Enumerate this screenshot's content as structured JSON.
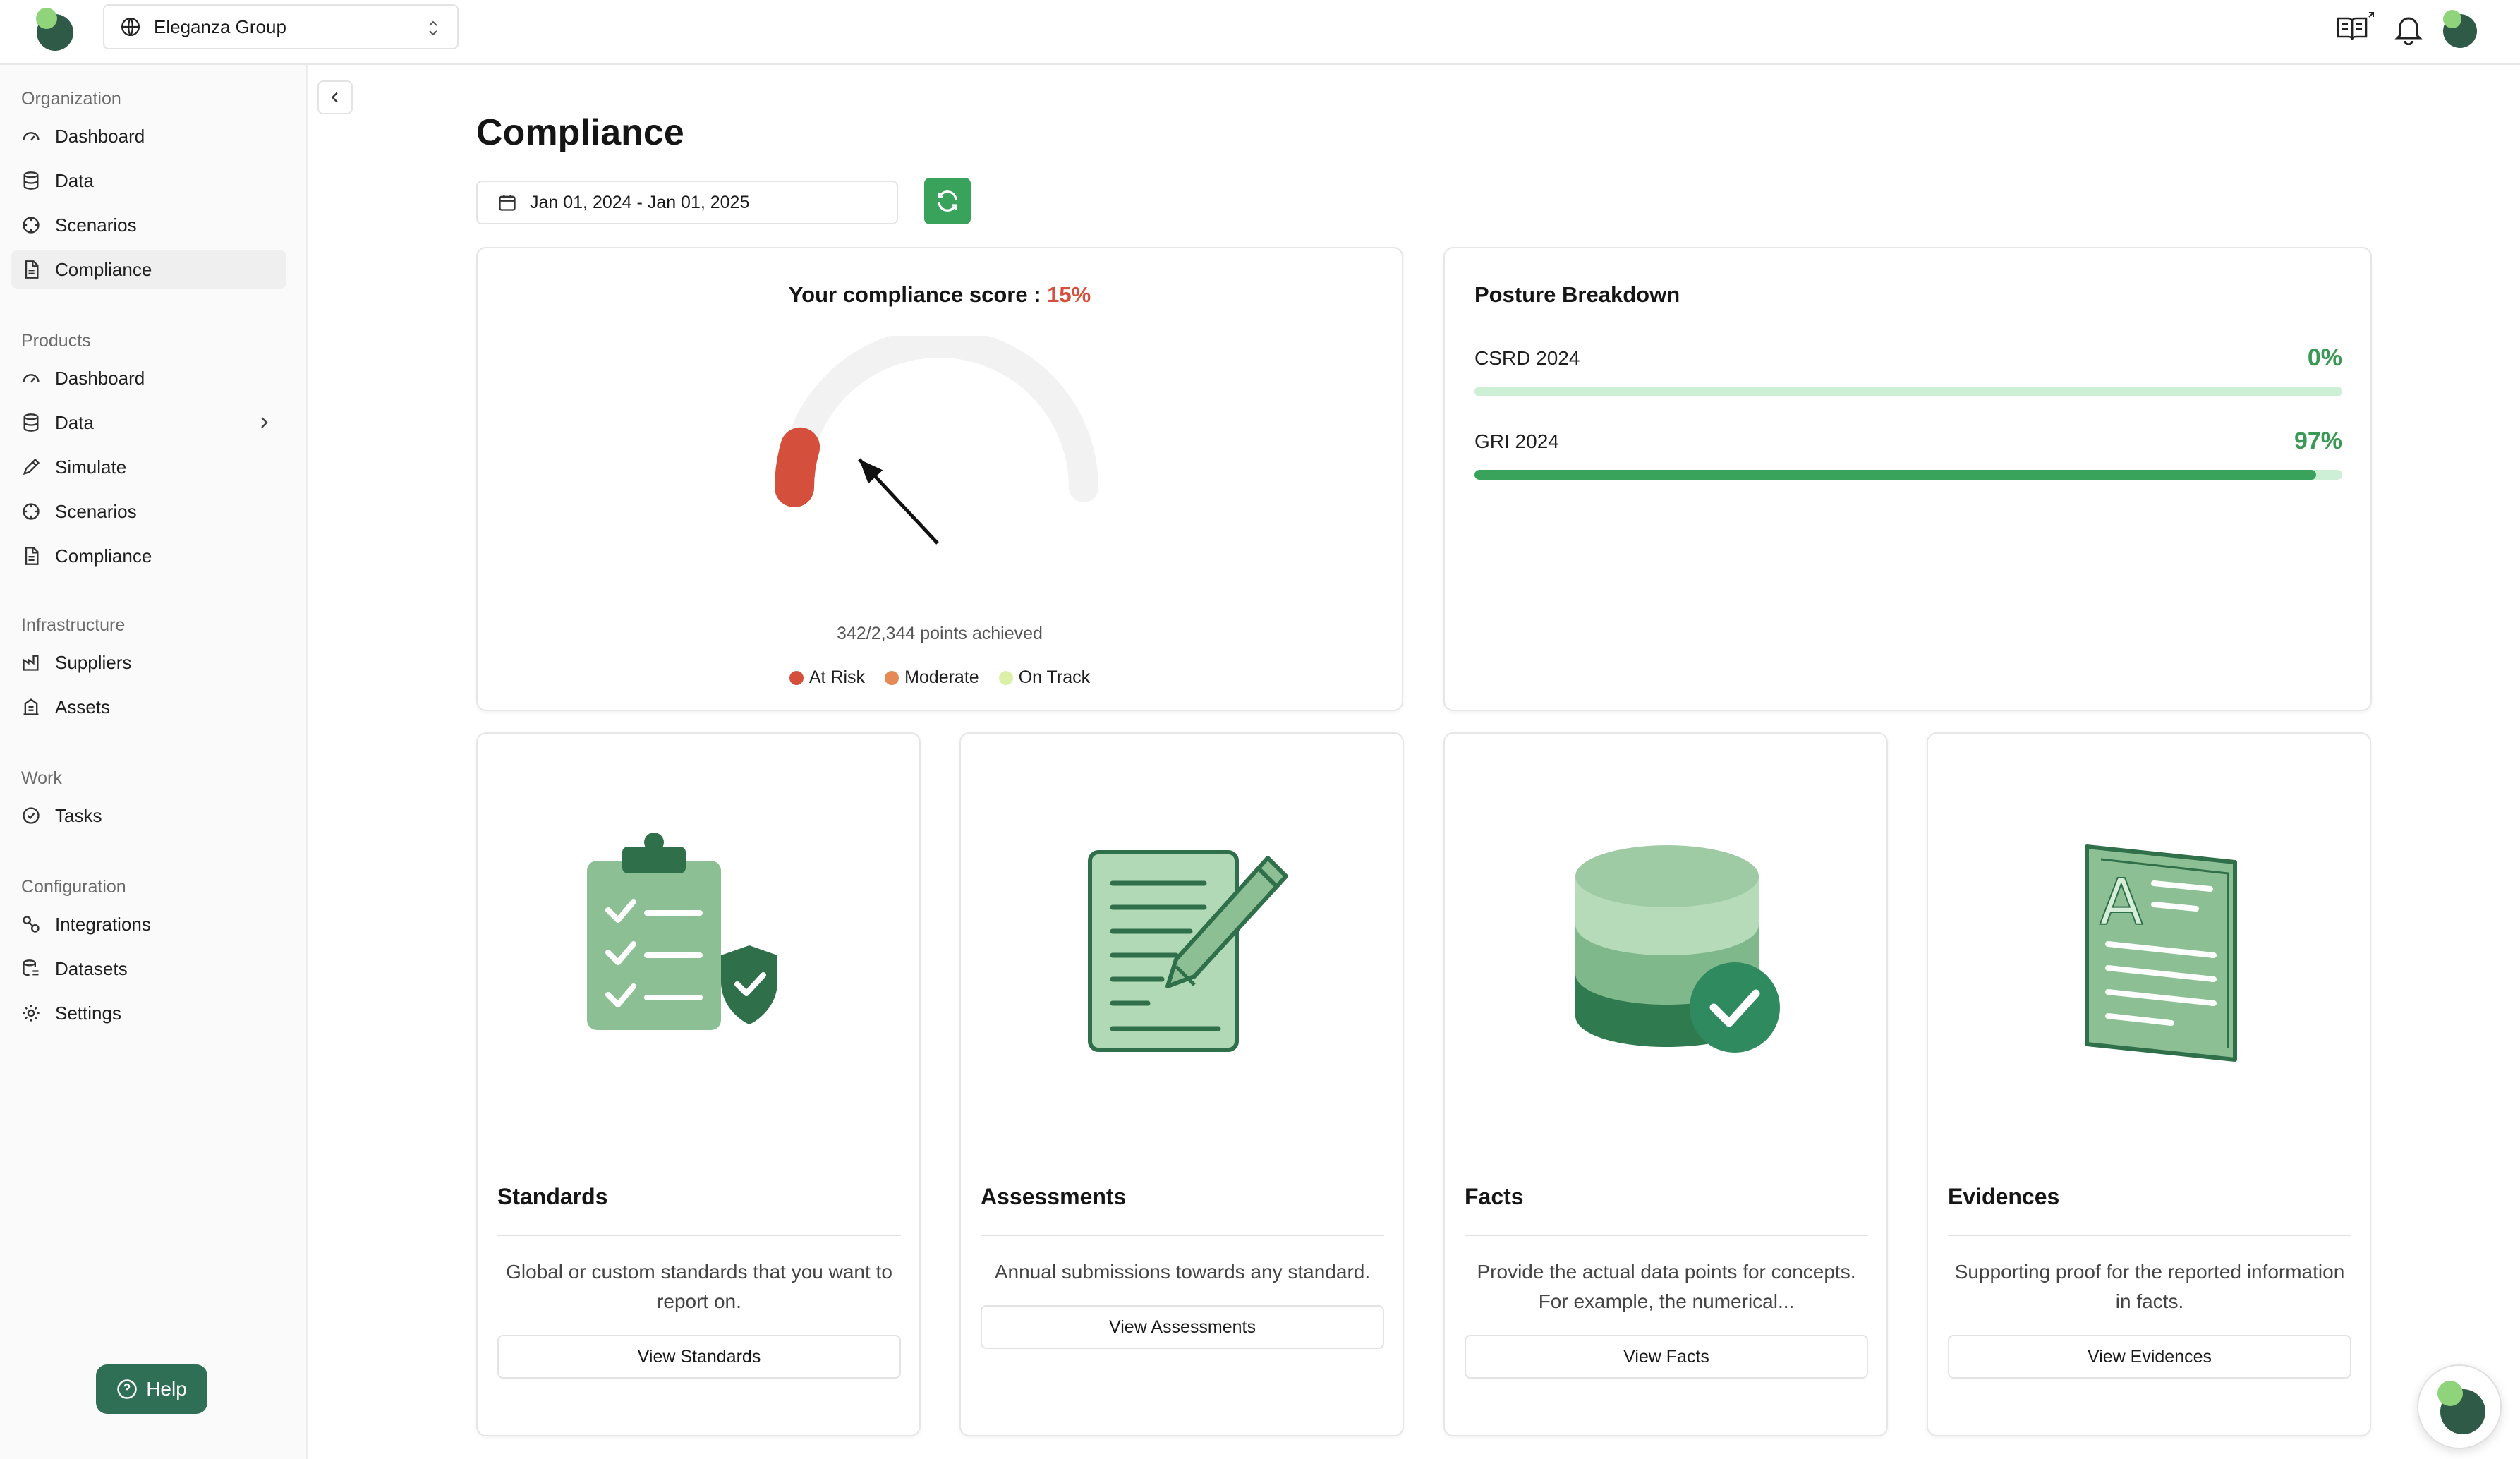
{
  "header": {
    "org_name": "Eleganza Group"
  },
  "sidebar": {
    "sections": [
      {
        "title": "Organization",
        "items": [
          "Dashboard",
          "Data",
          "Scenarios",
          "Compliance"
        ]
      },
      {
        "title": "Products",
        "items": [
          "Dashboard",
          "Data",
          "Simulate",
          "Scenarios",
          "Compliance"
        ]
      },
      {
        "title": "Infrastructure",
        "items": [
          "Suppliers",
          "Assets"
        ]
      },
      {
        "title": "Work",
        "items": [
          "Tasks"
        ]
      },
      {
        "title": "Configuration",
        "items": [
          "Integrations",
          "Datasets",
          "Settings"
        ]
      }
    ],
    "active_item": "Compliance",
    "help_label": "Help"
  },
  "main": {
    "title": "Compliance",
    "date_range": "Jan 01, 2024 - Jan 01, 2025"
  },
  "score": {
    "label": "Your compliance score :",
    "value": "15%",
    "fraction": 0.15,
    "points": "342/2,344 points achieved",
    "legend": [
      {
        "label": "At Risk",
        "color": "#d4503d"
      },
      {
        "label": "Moderate",
        "color": "#e68a55"
      },
      {
        "label": "On Track",
        "color": "#dcefa8"
      }
    ]
  },
  "posture": {
    "title": "Posture Breakdown",
    "rows": [
      {
        "name": "CSRD 2024",
        "value": "0%",
        "fraction": 0.0
      },
      {
        "name": "GRI 2024",
        "value": "97%",
        "fraction": 0.97
      }
    ]
  },
  "features": [
    {
      "icon": "clipboard-shield-icon",
      "title": "Standards",
      "desc": "Global or custom standards that you want to report on.",
      "button": "View Standards"
    },
    {
      "icon": "document-pencil-icon",
      "title": "Assessments",
      "desc": "Annual submissions towards any standard.",
      "button": "View Assessments"
    },
    {
      "icon": "database-check-icon",
      "title": "Facts",
      "desc": "Provide the actual data points for concepts. For example, the numerical...",
      "button": "View Facts"
    },
    {
      "icon": "evidence-document-icon",
      "title": "Evidences",
      "desc": "Supporting proof for the reported information in facts.",
      "button": "View Evidences"
    }
  ],
  "colors": {
    "brand_dark": "#2f6f55",
    "brand_green": "#3aa35b",
    "at_risk": "#d4503d"
  }
}
